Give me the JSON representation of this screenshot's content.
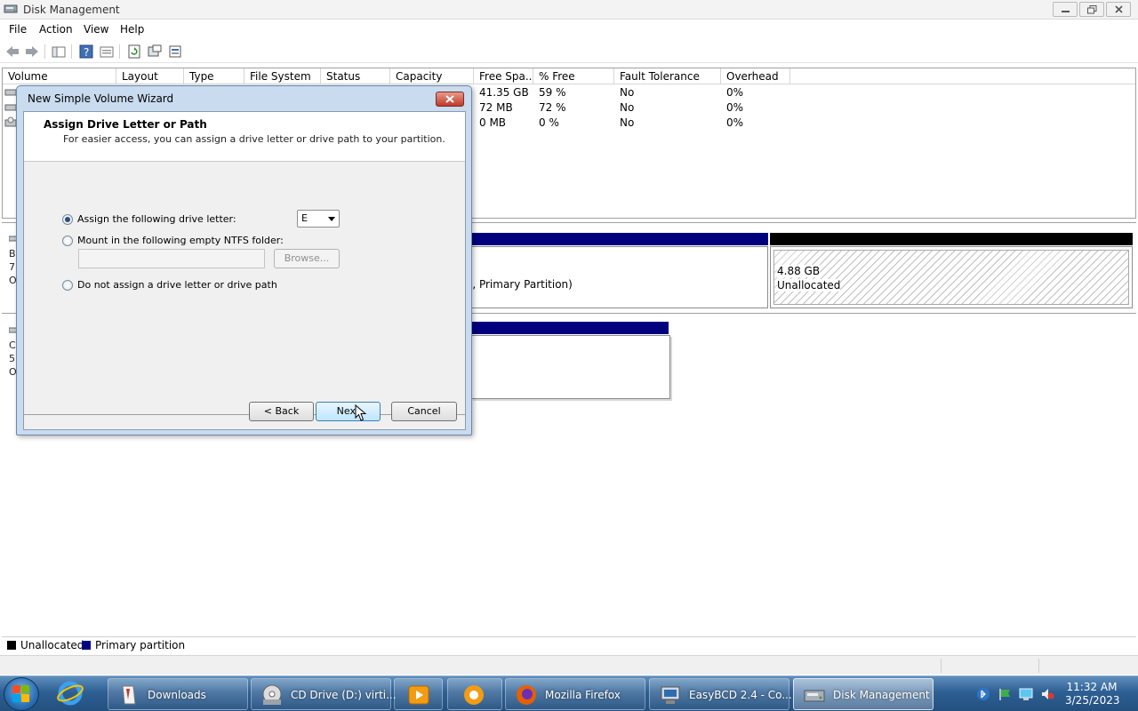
{
  "window": {
    "title": "Disk Management"
  },
  "menu": [
    "File",
    "Action",
    "View",
    "Help"
  ],
  "volume_list": {
    "headers": [
      "Volume",
      "Layout",
      "Type",
      "File System",
      "Status",
      "Capacity",
      "Free Spa...",
      "% Free",
      "Fault Tolerance",
      "Overhead"
    ],
    "rows": [
      {
        "free": "41.35 GB",
        "pct": "59 %",
        "fault": "No",
        "overhead": "0%"
      },
      {
        "free": "72 MB",
        "pct": "72 %",
        "fault": "No",
        "overhead": "0%"
      },
      {
        "free": "0 MB",
        "pct": "0 %",
        "fault": "No",
        "overhead": "0%"
      }
    ]
  },
  "disk0": {
    "partition_text": "o, Primary Partition)",
    "unallocated_size": "4.88 GB",
    "unallocated_label": "Unallocated",
    "left_chars": [
      "B",
      "7",
      "O"
    ]
  },
  "disk1": {
    "left_chars": [
      "C",
      "5",
      "O"
    ]
  },
  "legend": {
    "unallocated": "Unallocated",
    "primary": "Primary partition"
  },
  "colors": {
    "primary": "#00007f",
    "unallocated": "#000000",
    "dialog_frame": "#c9dbef"
  },
  "dialog": {
    "title": "New Simple Volume Wizard",
    "heading": "Assign Drive Letter or Path",
    "subheading": "For easier access, you can assign a drive letter or drive path to your partition.",
    "option_assign": "Assign the following drive letter:",
    "drive_letter": "E",
    "option_mount": "Mount in the following empty NTFS folder:",
    "browse": "Browse...",
    "option_none": "Do not assign a drive letter or drive path",
    "back": "< Back",
    "next": "Next",
    "cancel": "Cancel"
  },
  "taskbar": {
    "items": [
      "Downloads",
      "CD Drive (D:) virti...",
      "",
      "",
      "Mozilla Firefox",
      "EasyBCD 2.4 - Co...",
      "Disk Management"
    ],
    "time": "11:32 AM",
    "date": "3/25/2023"
  }
}
